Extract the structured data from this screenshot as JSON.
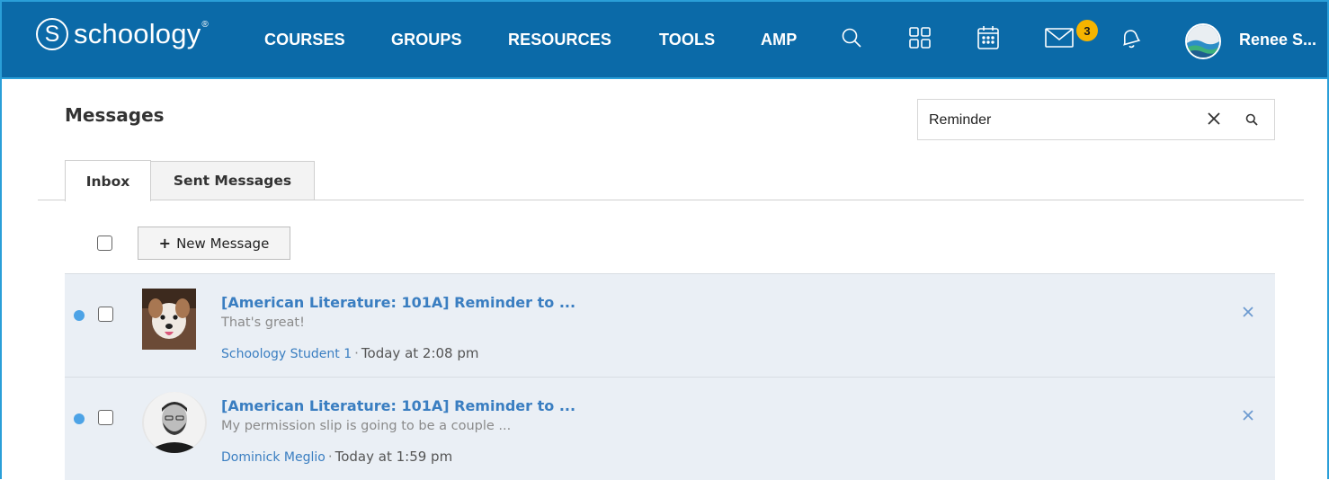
{
  "brand": {
    "name": "schoology",
    "mark": "S",
    "tm": "®"
  },
  "nav": {
    "links": [
      "COURSES",
      "GROUPS",
      "RESOURCES",
      "TOOLS",
      "AMP"
    ],
    "icons": [
      "search-icon",
      "apps-grid-icon",
      "calendar-icon",
      "mail-icon",
      "bell-icon"
    ],
    "mail_badge": "3",
    "user_name": "Renee S..."
  },
  "page": {
    "title": "Messages"
  },
  "search": {
    "value": "Reminder",
    "clear_icon": "close-icon",
    "go_icon": "search-icon"
  },
  "tabs": [
    {
      "label": "Inbox",
      "active": true
    },
    {
      "label": "Sent Messages",
      "active": false
    }
  ],
  "toolbar": {
    "new_message_plus": "+",
    "new_message_label": "New Message"
  },
  "messages": [
    {
      "subject": "[American Literature: 101A] Reminder to ...",
      "preview": "That's great!",
      "sender": "Schoology Student 1",
      "separator": "·",
      "time": "Today at 2:08 pm",
      "unread": true
    },
    {
      "subject": "[American Literature: 101A] Reminder to ...",
      "preview": "My permission slip is going to be a couple ...",
      "sender": "Dominick Meglio",
      "separator": "·",
      "time": "Today at 1:59 pm",
      "unread": true
    }
  ],
  "colors": {
    "nav_bg": "#0b6aa8",
    "link": "#3a7ec1",
    "unread_dot": "#4da3e6",
    "badge": "#f5b400"
  }
}
